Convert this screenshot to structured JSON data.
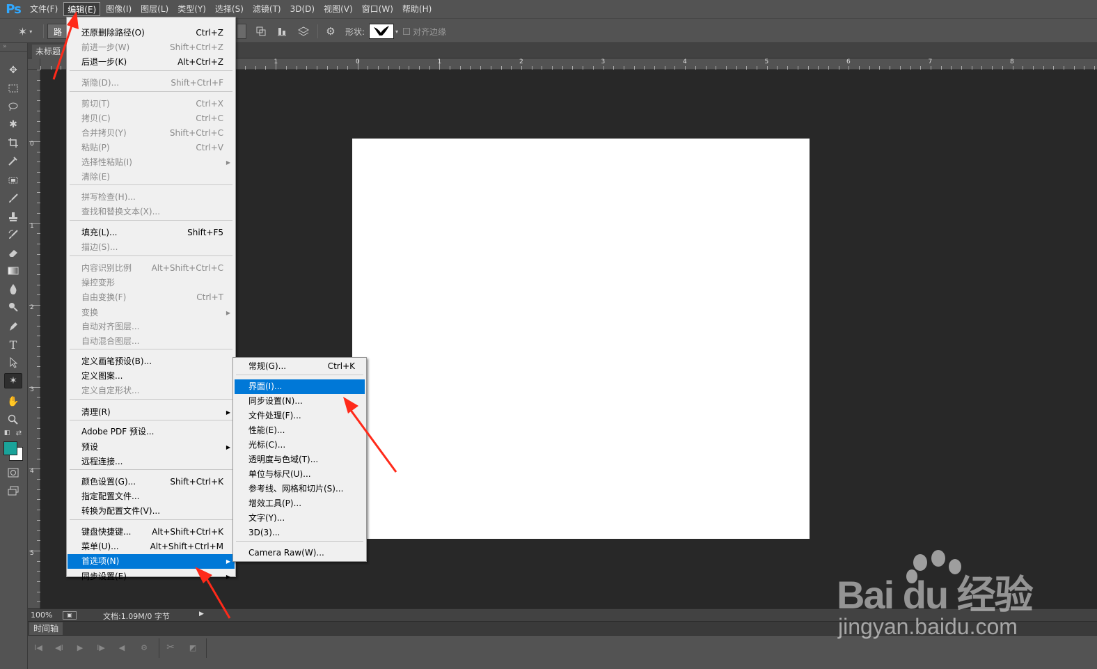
{
  "app": {
    "logo": "Ps"
  },
  "menubar": {
    "items": [
      "文件(F)",
      "编辑(E)",
      "图像(I)",
      "图层(L)",
      "类型(Y)",
      "选择(S)",
      "滤镜(T)",
      "3D(D)",
      "视图(V)",
      "窗口(W)",
      "帮助(H)"
    ],
    "active_index": 1
  },
  "options_bar": {
    "tool_preset_icon": "custom-shape-icon",
    "path_mode_label": "路",
    "shape_label": "形状:",
    "align_edges_label": "对齐边缘",
    "align_edges_checked": false
  },
  "document": {
    "tab_title": "未标题",
    "zoom": "100%",
    "doc_info": "文档:1.09M/0 字节",
    "ruler_top_labels": [
      "1",
      "0",
      "1",
      "2",
      "3",
      "4",
      "5",
      "6",
      "7",
      "8"
    ],
    "ruler_left_labels": [
      "0",
      "1",
      "2",
      "3",
      "4",
      "5"
    ]
  },
  "timeline": {
    "tab_label": "时间轴"
  },
  "edit_menu": {
    "items": [
      {
        "label": "还原删除路径(O)",
        "shortcut": "Ctrl+Z",
        "enabled": true
      },
      {
        "label": "前进一步(W)",
        "shortcut": "Shift+Ctrl+Z",
        "enabled": false
      },
      {
        "label": "后退一步(K)",
        "shortcut": "Alt+Ctrl+Z",
        "enabled": true
      },
      {
        "label": "渐隐(D)...",
        "shortcut": "Shift+Ctrl+F",
        "enabled": false
      },
      {
        "label": "剪切(T)",
        "shortcut": "Ctrl+X",
        "enabled": false
      },
      {
        "label": "拷贝(C)",
        "shortcut": "Ctrl+C",
        "enabled": false
      },
      {
        "label": "合并拷贝(Y)",
        "shortcut": "Shift+Ctrl+C",
        "enabled": false
      },
      {
        "label": "粘贴(P)",
        "shortcut": "Ctrl+V",
        "enabled": false
      },
      {
        "label": "选择性粘贴(I)",
        "shortcut": "",
        "enabled": false,
        "submenu": true
      },
      {
        "label": "清除(E)",
        "shortcut": "",
        "enabled": false
      },
      {
        "label": "拼写检查(H)...",
        "shortcut": "",
        "enabled": false
      },
      {
        "label": "查找和替换文本(X)...",
        "shortcut": "",
        "enabled": false
      },
      {
        "label": "填充(L)...",
        "shortcut": "Shift+F5",
        "enabled": true
      },
      {
        "label": "描边(S)...",
        "shortcut": "",
        "enabled": false
      },
      {
        "label": "内容识别比例",
        "shortcut": "Alt+Shift+Ctrl+C",
        "enabled": false
      },
      {
        "label": "操控变形",
        "shortcut": "",
        "enabled": false
      },
      {
        "label": "自由变换(F)",
        "shortcut": "Ctrl+T",
        "enabled": false
      },
      {
        "label": "变换",
        "shortcut": "",
        "enabled": false,
        "submenu": true
      },
      {
        "label": "自动对齐图层...",
        "shortcut": "",
        "enabled": false
      },
      {
        "label": "自动混合图层...",
        "shortcut": "",
        "enabled": false
      },
      {
        "label": "定义画笔预设(B)...",
        "shortcut": "",
        "enabled": true
      },
      {
        "label": "定义图案...",
        "shortcut": "",
        "enabled": true
      },
      {
        "label": "定义自定形状...",
        "shortcut": "",
        "enabled": false
      },
      {
        "label": "清理(R)",
        "shortcut": "",
        "enabled": true,
        "submenu": true
      },
      {
        "label": "Adobe PDF 预设...",
        "shortcut": "",
        "enabled": true
      },
      {
        "label": "预设",
        "shortcut": "",
        "enabled": true,
        "submenu": true
      },
      {
        "label": "远程连接...",
        "shortcut": "",
        "enabled": true
      },
      {
        "label": "颜色设置(G)...",
        "shortcut": "Shift+Ctrl+K",
        "enabled": true
      },
      {
        "label": "指定配置文件...",
        "shortcut": "",
        "enabled": true
      },
      {
        "label": "转换为配置文件(V)...",
        "shortcut": "",
        "enabled": true
      },
      {
        "label": "键盘快捷键...",
        "shortcut": "Alt+Shift+Ctrl+K",
        "enabled": true
      },
      {
        "label": "菜单(U)...",
        "shortcut": "Alt+Shift+Ctrl+M",
        "enabled": true
      },
      {
        "label": "首选项(N)",
        "shortcut": "",
        "enabled": true,
        "submenu": true,
        "highlighted": true
      },
      {
        "label": "同步设置(E)",
        "shortcut": "",
        "enabled": true,
        "submenu": true
      }
    ]
  },
  "preferences_submenu": {
    "items": [
      {
        "label": "常规(G)...",
        "shortcut": "Ctrl+K"
      },
      {
        "label": "界面(I)...",
        "shortcut": "",
        "highlighted": true
      },
      {
        "label": "同步设置(N)...",
        "shortcut": ""
      },
      {
        "label": "文件处理(F)...",
        "shortcut": ""
      },
      {
        "label": "性能(E)...",
        "shortcut": ""
      },
      {
        "label": "光标(C)...",
        "shortcut": ""
      },
      {
        "label": "透明度与色域(T)...",
        "shortcut": ""
      },
      {
        "label": "单位与标尺(U)...",
        "shortcut": ""
      },
      {
        "label": "参考线、网格和切片(S)...",
        "shortcut": ""
      },
      {
        "label": "增效工具(P)...",
        "shortcut": ""
      },
      {
        "label": "文字(Y)...",
        "shortcut": ""
      },
      {
        "label": "3D(3)...",
        "shortcut": ""
      },
      {
        "label": "Camera Raw(W)...",
        "shortcut": ""
      }
    ]
  },
  "watermark": {
    "logo_text": "Bai du 经验",
    "url": "jingyan.baidu.com"
  },
  "colors": {
    "foreground": "#1aa39a",
    "background": "#ffffff",
    "highlight": "#0078d7",
    "annotation": "#ff2a1a"
  }
}
